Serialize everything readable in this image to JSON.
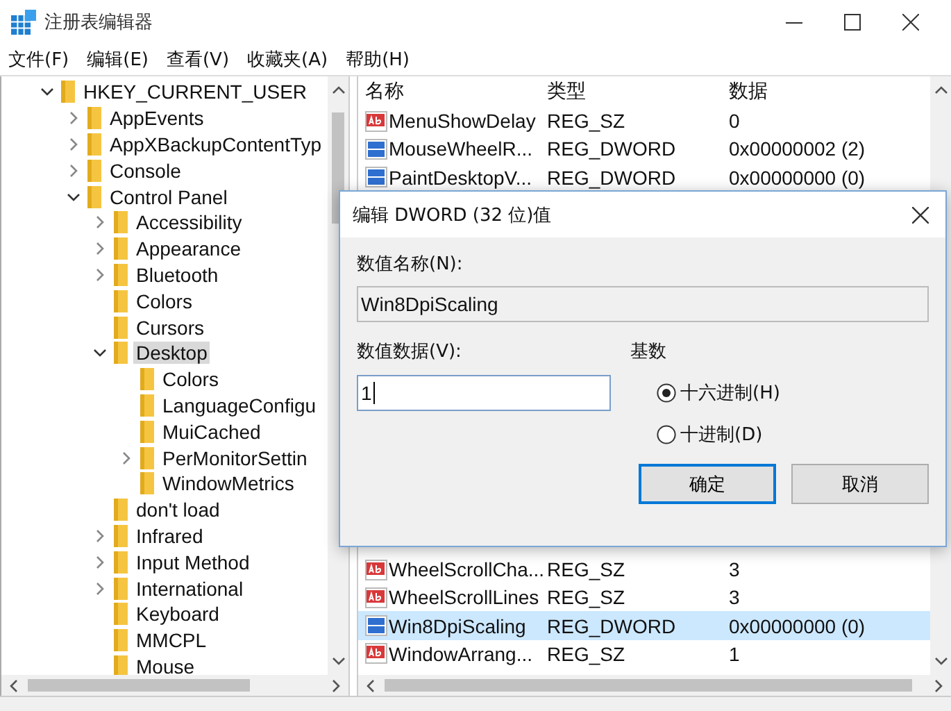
{
  "window": {
    "title": "注册表编辑器"
  },
  "menu": [
    "文件(F)",
    "编辑(E)",
    "查看(V)",
    "收藏夹(A)",
    "帮助(H)"
  ],
  "tree": [
    {
      "label": "HKEY_CURRENT_USER",
      "expanded": true,
      "selected": false,
      "children": [
        {
          "label": "AppEvents",
          "expanded": false,
          "selected": false
        },
        {
          "label": "AppXBackupContentTyp",
          "expanded": false,
          "selected": false
        },
        {
          "label": "Console",
          "expanded": false,
          "selected": false
        },
        {
          "label": "Control Panel",
          "expanded": true,
          "selected": false,
          "children": [
            {
              "label": "Accessibility",
              "expanded": false,
              "selected": false
            },
            {
              "label": "Appearance",
              "expanded": false,
              "selected": false
            },
            {
              "label": "Bluetooth",
              "expanded": false,
              "selected": false
            },
            {
              "label": "Colors",
              "selected": false
            },
            {
              "label": "Cursors",
              "selected": false
            },
            {
              "label": "Desktop",
              "expanded": true,
              "selected": true,
              "children": [
                {
                  "label": "Colors",
                  "selected": false
                },
                {
                  "label": "LanguageConfigu",
                  "selected": false
                },
                {
                  "label": "MuiCached",
                  "selected": false
                },
                {
                  "label": "PerMonitorSettin",
                  "expanded": false,
                  "selected": false
                },
                {
                  "label": "WindowMetrics",
                  "selected": false
                }
              ]
            },
            {
              "label": "don't load",
              "selected": false
            },
            {
              "label": "Infrared",
              "expanded": false,
              "selected": false
            },
            {
              "label": "Input Method",
              "expanded": false,
              "selected": false
            },
            {
              "label": "International",
              "expanded": false,
              "selected": false
            },
            {
              "label": "Keyboard",
              "selected": false
            },
            {
              "label": "MMCPL",
              "selected": false
            },
            {
              "label": "Mouse",
              "selected": false
            }
          ]
        }
      ]
    }
  ],
  "values": {
    "columns": [
      "名称",
      "类型",
      "数据"
    ],
    "rows_top": [
      {
        "kind": "sz",
        "name": "MenuShowDelay",
        "type": "REG_SZ",
        "data": "0",
        "selected": false
      },
      {
        "kind": "dword",
        "name": "MouseWheelR...",
        "type": "REG_DWORD",
        "data": "0x00000002 (2)",
        "selected": false
      },
      {
        "kind": "dword",
        "name": "PaintDesktopV...",
        "type": "REG_DWORD",
        "data": "0x00000000 (0)",
        "selected": false
      }
    ],
    "rows_bottom": [
      {
        "kind": "sz",
        "name": "WheelScrollCha...",
        "type": "REG_SZ",
        "data": "3",
        "selected": false
      },
      {
        "kind": "sz",
        "name": "WheelScrollLines",
        "type": "REG_SZ",
        "data": "3",
        "selected": false
      },
      {
        "kind": "dword",
        "name": "Win8DpiScaling",
        "type": "REG_DWORD",
        "data": "0x00000000 (0)",
        "selected": true
      },
      {
        "kind": "sz",
        "name": "WindowArrang...",
        "type": "REG_SZ",
        "data": "1",
        "selected": false
      }
    ]
  },
  "dialog": {
    "title": "编辑 DWORD (32 位)值",
    "name_label": "数值名称(N):",
    "name_value": "Win8DpiScaling",
    "data_label": "数值数据(V):",
    "data_value": "1",
    "base_label": "基数",
    "radios": [
      {
        "label": "十六进制(H)",
        "selected": true
      },
      {
        "label": "十进制(D)",
        "selected": false
      }
    ],
    "buttons": [
      {
        "label": "确定",
        "default": true
      },
      {
        "label": "取消",
        "default": false
      }
    ]
  }
}
